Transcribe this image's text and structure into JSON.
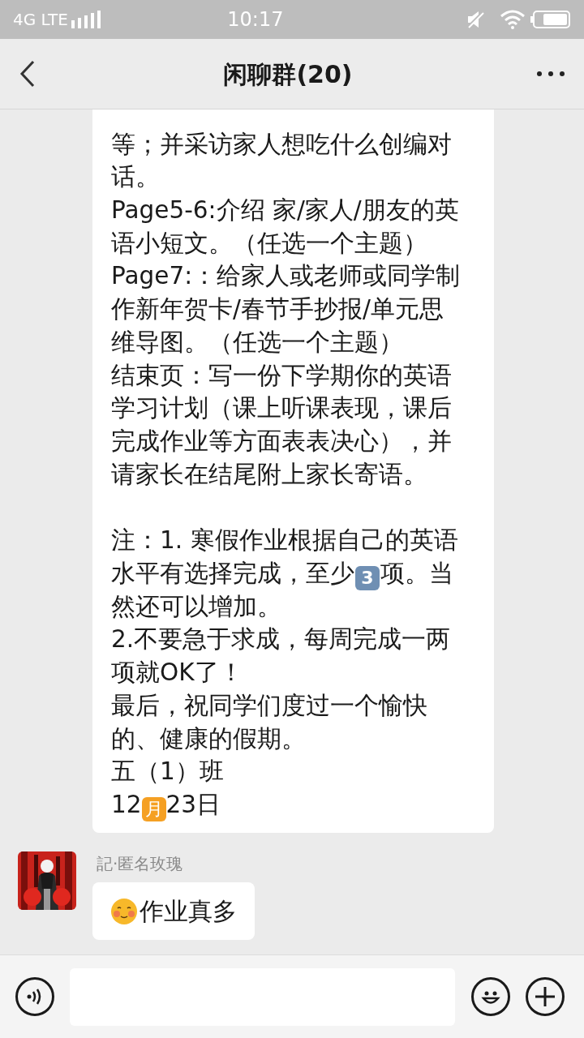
{
  "status_bar": {
    "network": "4G LTE",
    "time": "10:17"
  },
  "header": {
    "title": "闲聊群(20)"
  },
  "messages": [
    {
      "kind": "long",
      "paragraphs": [
        {
          "gap_before": false,
          "parts": [
            {
              "kind": "text",
              "text": "等；并采访家人想吃什么创编对话。"
            }
          ]
        },
        {
          "gap_before": false,
          "parts": [
            {
              "kind": "text",
              "text": "Page5-6:介绍 家/家人/朋友的英语小短文。（任选一个主题）"
            }
          ]
        },
        {
          "gap_before": false,
          "parts": [
            {
              "kind": "text",
              "text": "Page7:：给家人或老师或同学制作新年贺卡/春节手抄报/单元思维导图。（任选一个主题）"
            }
          ]
        },
        {
          "gap_before": false,
          "parts": [
            {
              "kind": "text",
              "text": "结束页：写一份下学期你的英语学习计划（课上听课表现，课后完成作业等方面表表决心），并请家长在结尾附上家长寄语。"
            }
          ]
        },
        {
          "gap_before": true,
          "parts": [
            {
              "kind": "text",
              "text": "注：1. 寒假作业根据自己的英语水平有选择完成，至少"
            },
            {
              "kind": "keycap",
              "text": "3"
            },
            {
              "kind": "text",
              "text": "项。当然还可以增加。"
            }
          ]
        },
        {
          "gap_before": false,
          "parts": [
            {
              "kind": "text",
              "text": "2.不要急于求成，每周完成一两项就OK了！"
            }
          ]
        },
        {
          "gap_before": false,
          "parts": [
            {
              "kind": "text",
              "text": "最后，祝同学们度过一个愉快的、健康的假期。"
            }
          ]
        },
        {
          "gap_before": false,
          "parts": [
            {
              "kind": "text",
              "text": "五（1）班"
            }
          ]
        },
        {
          "gap_before": false,
          "parts": [
            {
              "kind": "text",
              "text": "12"
            },
            {
              "kind": "badge",
              "text": "月"
            },
            {
              "kind": "text",
              "text": "23日"
            }
          ]
        }
      ]
    },
    {
      "kind": "short",
      "sender": "記·匿名玫瑰",
      "text": "作业真多"
    }
  ]
}
